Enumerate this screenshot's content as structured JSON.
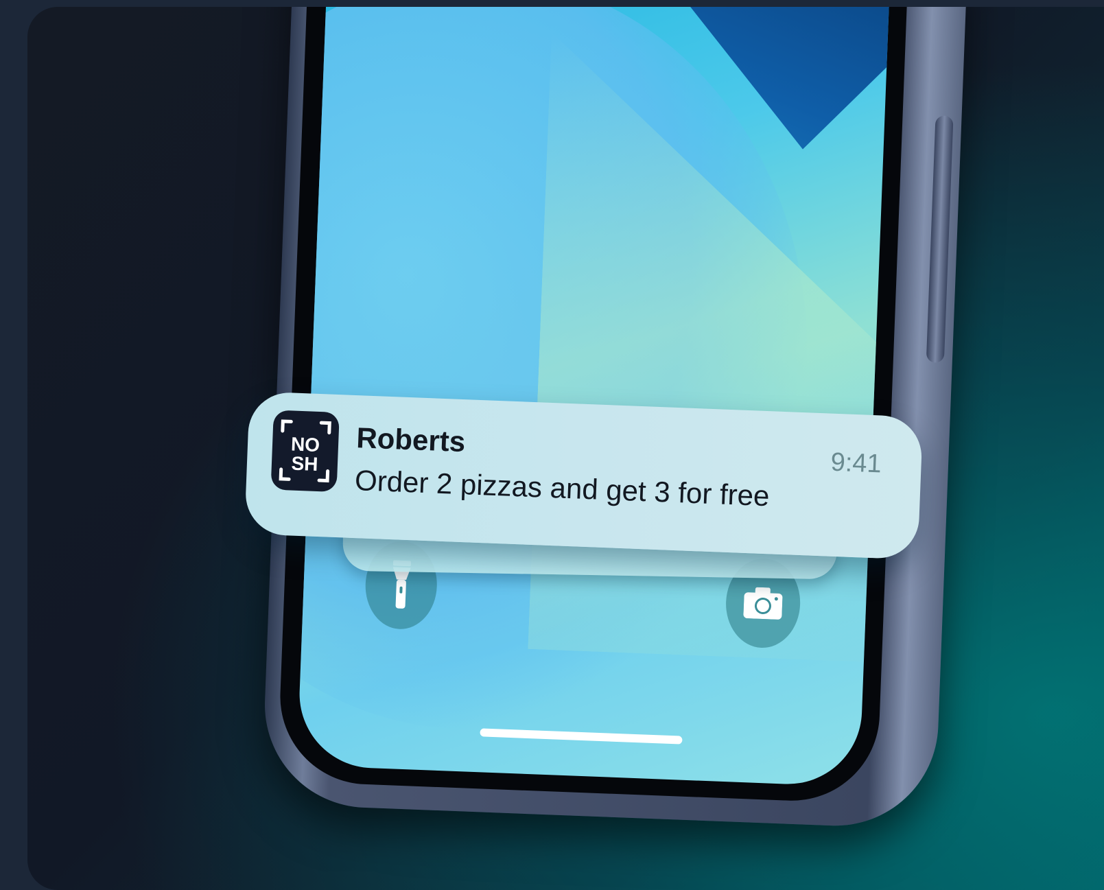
{
  "notification": {
    "app_name": "Roberts",
    "message": "Order 2 pizzas and get 3 for free",
    "time": "9:41",
    "icon_text_top": "NO",
    "icon_text_bottom": "SH"
  },
  "lock_screen": {
    "left_button_icon": "flashlight-icon",
    "right_button_icon": "camera-icon"
  },
  "colors": {
    "notification_bg": "#c8e6ee",
    "icon_bg": "#131a2b",
    "background_teal": "#045f66"
  }
}
